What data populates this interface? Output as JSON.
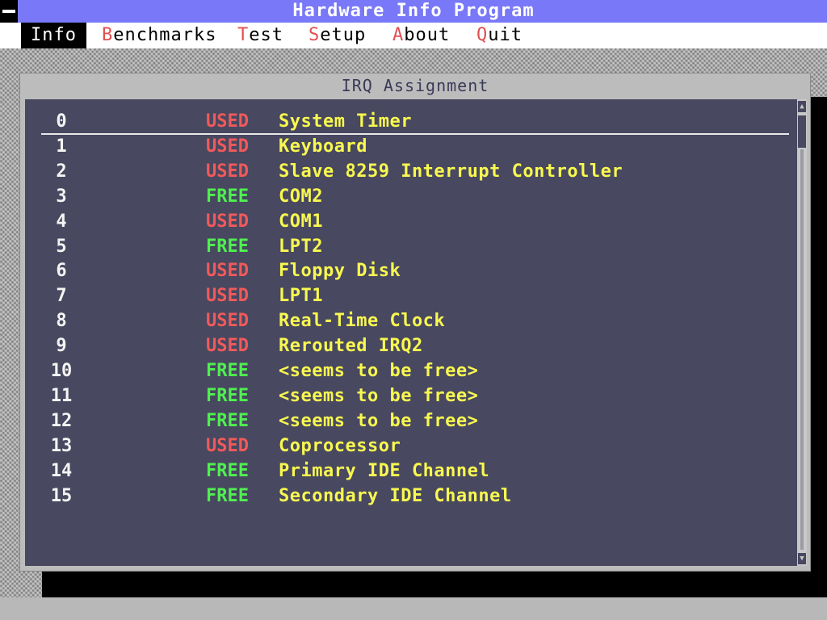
{
  "app": {
    "title": "Hardware Info Program"
  },
  "menu": [
    {
      "hot": "I",
      "rest": "nfo",
      "active": true
    },
    {
      "hot": "B",
      "rest": "enchmarks",
      "active": false
    },
    {
      "hot": "T",
      "rest": "est",
      "active": false
    },
    {
      "hot": "S",
      "rest": "etup",
      "active": false,
      "pre": ""
    },
    {
      "hot": "A",
      "rest": "bout",
      "active": false
    },
    {
      "hot": "Q",
      "rest": "uit",
      "active": false
    }
  ],
  "window": {
    "title": "IRQ Assignment"
  },
  "colors": {
    "used": "#f05a5a",
    "free": "#50f050",
    "device": "#f8f850",
    "panel": "#484860",
    "titlebar": "#7878f8"
  },
  "irqs": [
    {
      "irq": "0",
      "status": "USED",
      "device": "System Timer"
    },
    {
      "irq": "1",
      "status": "USED",
      "device": "Keyboard"
    },
    {
      "irq": "2",
      "status": "USED",
      "device": "Slave 8259 Interrupt Controller"
    },
    {
      "irq": "3",
      "status": "FREE",
      "device": "COM2"
    },
    {
      "irq": "4",
      "status": "USED",
      "device": "COM1"
    },
    {
      "irq": "5",
      "status": "FREE",
      "device": "LPT2"
    },
    {
      "irq": "6",
      "status": "USED",
      "device": "Floppy Disk"
    },
    {
      "irq": "7",
      "status": "USED",
      "device": "LPT1"
    },
    {
      "irq": "8",
      "status": "USED",
      "device": "Real-Time Clock"
    },
    {
      "irq": "9",
      "status": "USED",
      "device": "Rerouted IRQ2"
    },
    {
      "irq": "10",
      "status": "FREE",
      "device": "<seems to be free>"
    },
    {
      "irq": "11",
      "status": "FREE",
      "device": "<seems to be free>"
    },
    {
      "irq": "12",
      "status": "FREE",
      "device": "<seems to be free>"
    },
    {
      "irq": "13",
      "status": "USED",
      "device": "Coprocessor"
    },
    {
      "irq": "14",
      "status": "FREE",
      "device": "Primary IDE Channel"
    },
    {
      "irq": "15",
      "status": "FREE",
      "device": "Secondary IDE Channel"
    }
  ]
}
